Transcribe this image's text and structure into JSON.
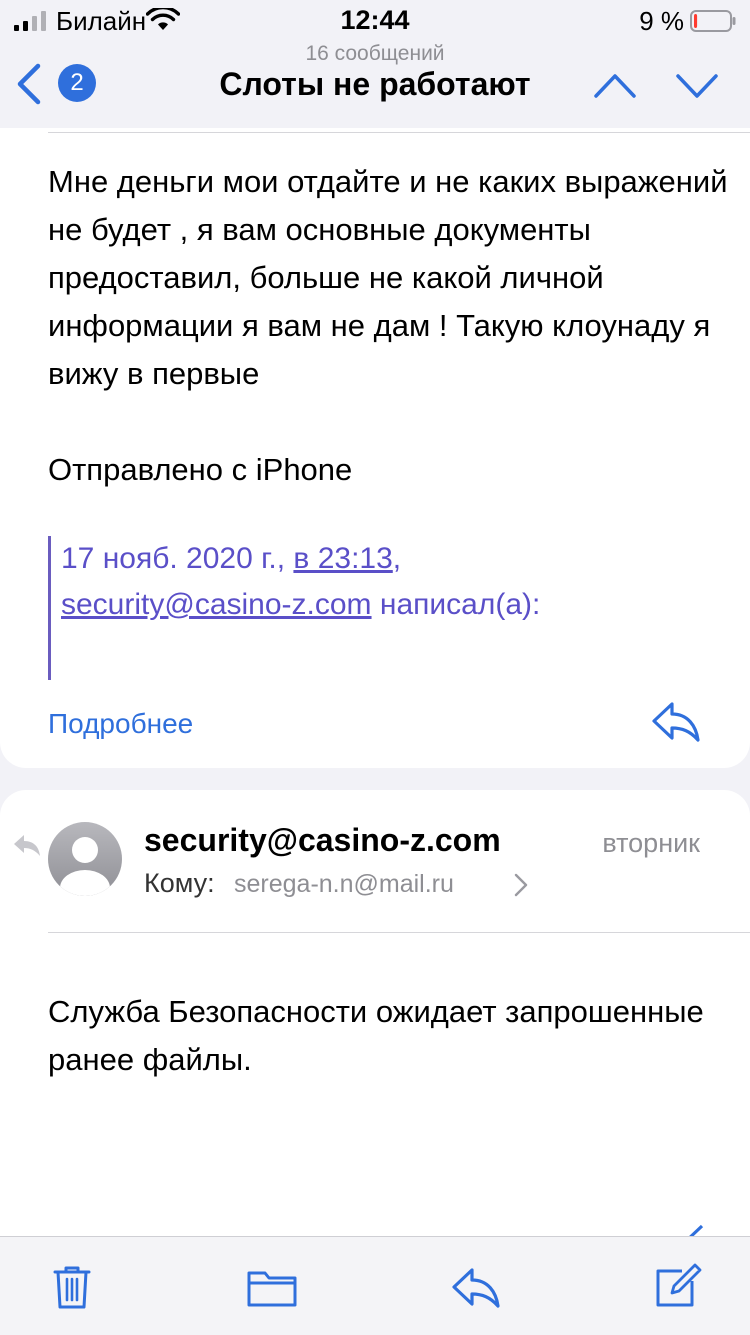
{
  "status_bar": {
    "carrier": "Билайн",
    "time": "12:44",
    "battery_percent": "9 %",
    "battery_level": 0.09,
    "battery_color": "#ff3b30"
  },
  "nav": {
    "back_icon": "chevron-left-icon",
    "unread_badge": "2",
    "message_count": "16 сообщений",
    "title": "Слоты не работают",
    "prev_icon": "chevron-up-icon",
    "next_icon": "chevron-down-icon",
    "accent_color": "#2f6fdc"
  },
  "message1": {
    "body": "Мне деньги мои отдайте и не каких выражений не будет , я вам основные документы предоставил, больше не какой личной информации я вам не дам ! Такую клоунаду я вижу в первые",
    "signature": "Отправлено с iPhone",
    "quote": {
      "date": "17 нояб. 2020 г.,",
      "time_link": "в 23:13",
      "comma": ",",
      "email_link": "security@casino-z.com",
      "wrote": "написал(а):"
    },
    "more_label": "Подробнее",
    "reply_icon": "reply-icon"
  },
  "message2": {
    "sender": "security@casino-z.com",
    "date": "вторник",
    "to_label": "Кому:",
    "to_value": "serega-n.n@mail.ru",
    "body": "Служба Безопасности ожидает запрошенные ранее файлы.",
    "replied_icon": "replied-indicator-icon",
    "avatar_icon": "avatar-person-icon"
  },
  "toolbar": {
    "trash_icon": "trash-icon",
    "folder_icon": "folder-icon",
    "reply_icon": "reply-icon",
    "compose_icon": "compose-icon"
  }
}
